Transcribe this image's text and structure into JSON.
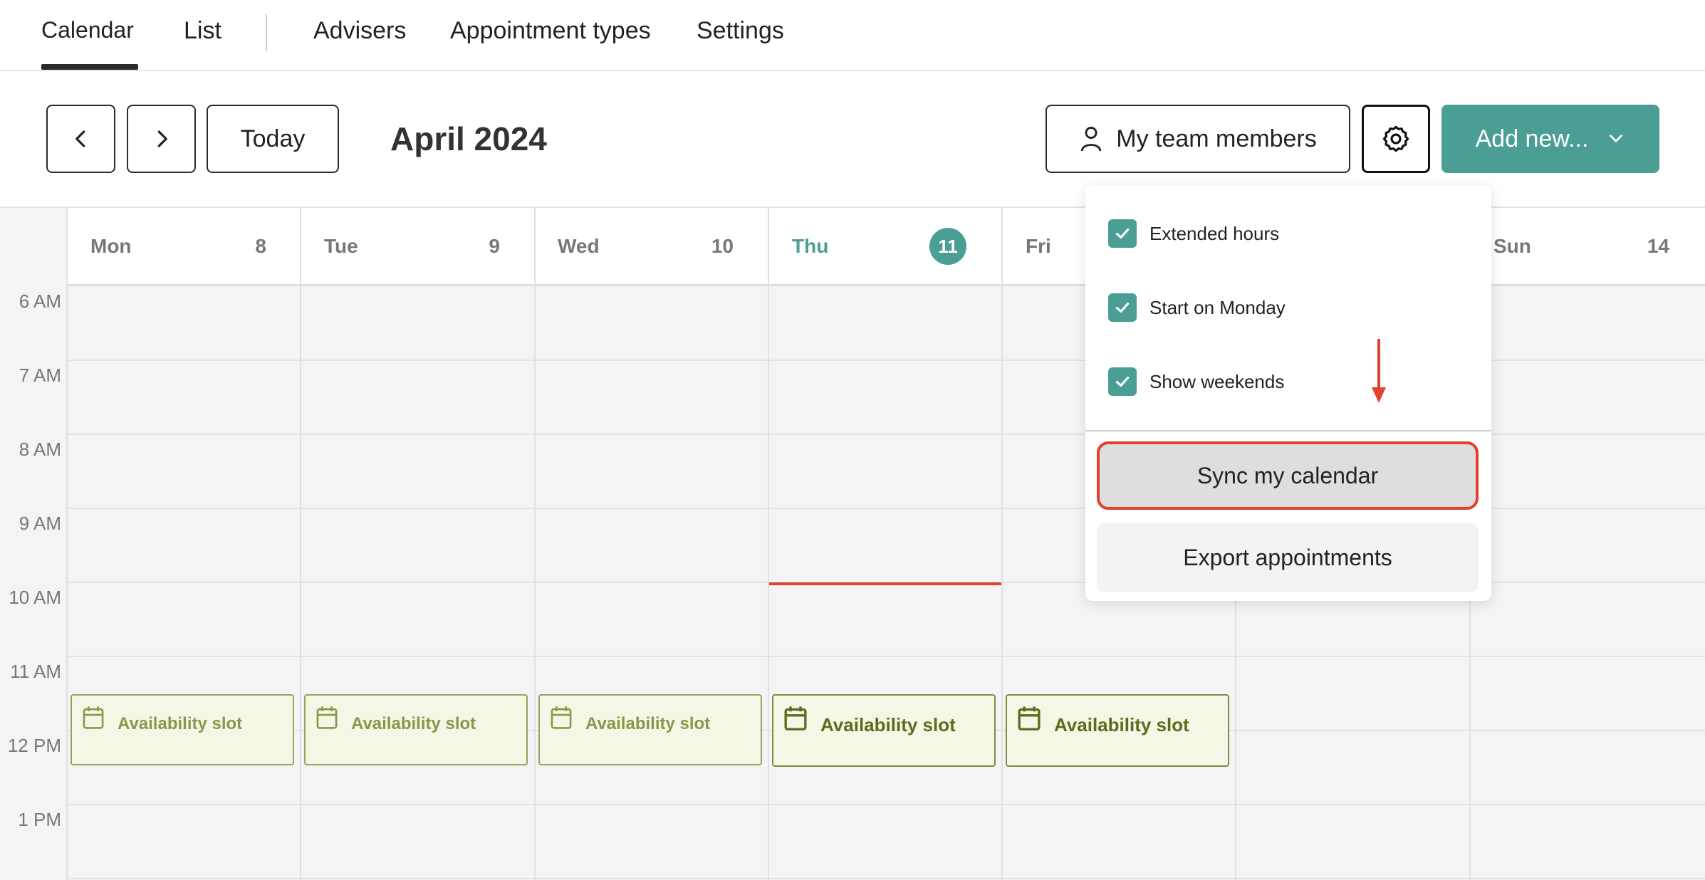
{
  "nav": {
    "tabs": [
      {
        "label": "Calendar",
        "active": true
      },
      {
        "label": "List",
        "active": false
      },
      {
        "label": "Advisers",
        "active": false
      },
      {
        "label": "Appointment types",
        "active": false
      },
      {
        "label": "Settings",
        "active": false
      }
    ]
  },
  "toolbar": {
    "prev_icon": "chevron-left-icon",
    "next_icon": "chevron-right-icon",
    "today_label": "Today",
    "month_title": "April 2024",
    "team_label": "My team members",
    "settings_icon": "gear-icon",
    "add_label": "Add new...",
    "accent_color": "#4a9e93"
  },
  "calendar": {
    "days": [
      {
        "name": "Mon",
        "num": "8"
      },
      {
        "name": "Tue",
        "num": "9"
      },
      {
        "name": "Wed",
        "num": "10"
      },
      {
        "name": "Thu",
        "num": "11",
        "today": true
      },
      {
        "name": "Fri",
        "num": ""
      },
      {
        "name": "",
        "num": ""
      },
      {
        "name": "Sun",
        "num": "14"
      }
    ],
    "times": [
      "6 AM",
      "7 AM",
      "8 AM",
      "9 AM",
      "10 AM",
      "11 AM",
      "12 PM",
      "1 PM"
    ],
    "slots": [
      {
        "label": "Availability slot"
      },
      {
        "label": "Availability slot"
      },
      {
        "label": "Availability slot"
      },
      {
        "label": "Availability slot"
      },
      {
        "label": "Availability slot"
      }
    ],
    "now_line_color": "#e0422c"
  },
  "dropdown": {
    "options": [
      {
        "label": "Extended hours",
        "checked": true
      },
      {
        "label": "Start on Monday",
        "checked": true
      },
      {
        "label": "Show weekends",
        "checked": true
      }
    ],
    "sync_label": "Sync my calendar",
    "export_label": "Export appointments",
    "highlight_color": "#e0422c"
  }
}
